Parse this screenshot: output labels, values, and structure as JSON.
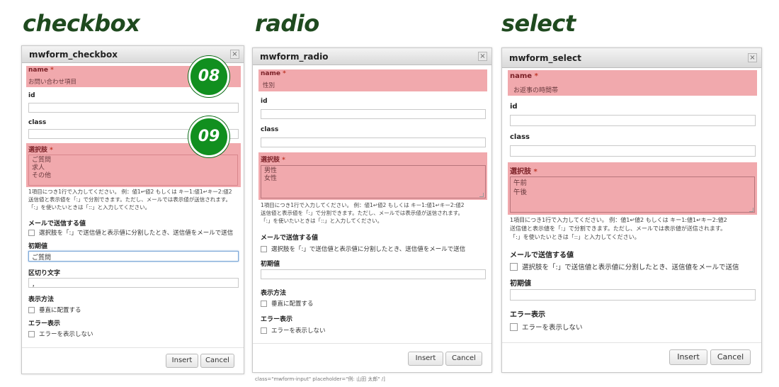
{
  "sections": {
    "checkbox_title": "checkbox",
    "radio_title": "radio",
    "select_title": "select"
  },
  "common": {
    "id_label": "id",
    "class_label": "class",
    "options_label": "選択肢",
    "required_mark": "*",
    "help_line1": "1項目につき1行で入力してください。 例：値1↵値2 もしくは キー1:値1↵キー2:値2",
    "help_line2": "送信値と表示値を「:」で分割できます。ただし、メールでは表示値が送信されます。",
    "help_line3": "「:」を使いたいときは「::」と入力してください。",
    "mail_value_label": "メールで送信する値",
    "mail_value_checkbox": "選択肢を「:」で送信値と表示値に分割したとき、送信値をメールで送信",
    "initial_label": "初期値",
    "error_label": "エラー表示",
    "error_checkbox": "エラーを表示しない",
    "insert_button": "Insert",
    "cancel_button": "Cancel",
    "close_glyph": "×"
  },
  "checkbox_dialog": {
    "title": "mwform_checkbox",
    "name_label": "name",
    "name_value": "お問い合わせ項目",
    "options": [
      "ご質問",
      "求人",
      "その他"
    ],
    "initial_value": "ご質問",
    "separator_label": "区切り文字",
    "separator_value": "，",
    "display_label": "表示方法",
    "display_checkbox": "垂直に配置する",
    "badge_08": "08",
    "badge_09": "09"
  },
  "radio_dialog": {
    "title": "mwform_radio",
    "name_label": "name",
    "name_value": "性別",
    "options": [
      "男性",
      "女性"
    ],
    "initial_value": "",
    "display_label": "表示方法",
    "display_checkbox": "垂直に配置する",
    "bottom_fragment": "class=\"mwform-input\" placeholder=\"例: 山田 太郎\" /]"
  },
  "select_dialog": {
    "title": "mwform_select",
    "name_label": "name",
    "name_value": "お返事の時間帯",
    "options": [
      "午前",
      "午後"
    ],
    "initial_value": ""
  }
}
